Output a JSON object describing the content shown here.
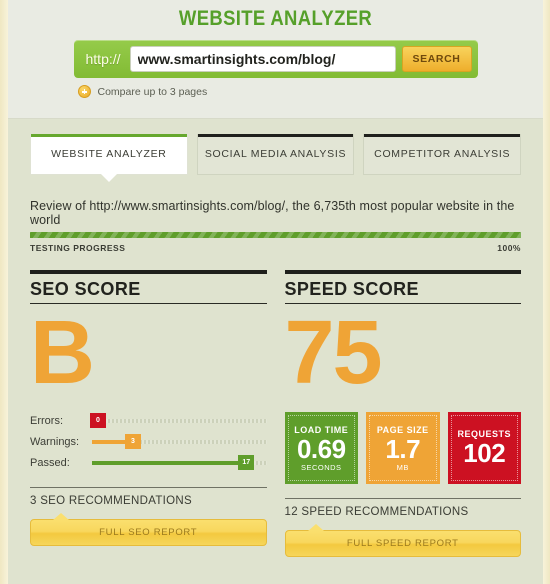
{
  "header": {
    "title": "WEBSITE ANALYZER",
    "protocol_label": "http://",
    "url_value": "www.smartinsights.com/blog/",
    "url_placeholder": "www.smartinsights.com/blog/",
    "search_button": "SEARCH",
    "compare_label": "Compare up to 3 pages",
    "plus_icon": "plus-circle-icon",
    "title_color": "#56a02a"
  },
  "tabs": [
    {
      "label": "WEBSITE ANALYZER",
      "active": true
    },
    {
      "label": "SOCIAL MEDIA ANALYSIS",
      "active": false
    },
    {
      "label": "COMPETITOR ANALYSIS",
      "active": false
    }
  ],
  "review": {
    "text": "Review of http://www.smartinsights.com/blog/, the 6,735th most popular website in the world",
    "progress_label": "TESTING PROGRESS",
    "progress_percent": "100%",
    "progress_value": 100,
    "progress_color": "#5f9e2b"
  },
  "seo": {
    "title": "SEO SCORE",
    "grade": "B",
    "grade_color": "#efa436",
    "sliders": [
      {
        "name": "Errors:",
        "value": "0",
        "fill_percent": 0,
        "color": "#cc1122"
      },
      {
        "name": "Warnings:",
        "value": "3",
        "fill_percent": 20,
        "color": "#efa436"
      },
      {
        "name": "Passed:",
        "value": "17",
        "fill_percent": 85,
        "color": "#5f9e2b"
      }
    ],
    "recommendations": "3 SEO RECOMMENDATIONS",
    "report_button": "FULL SEO REPORT"
  },
  "speed": {
    "title": "SPEED SCORE",
    "score": "75",
    "score_color": "#efa436",
    "metrics": [
      {
        "label": "LOAD TIME",
        "value": "0.69",
        "unit": "SECONDS",
        "color": "#5f9e2b"
      },
      {
        "label": "PAGE SIZE",
        "value": "1.7",
        "unit": "MB",
        "color": "#efa436"
      },
      {
        "label": "REQUESTS",
        "value": "102",
        "unit": "",
        "color": "#cc1122"
      }
    ],
    "recommendations": "12 SPEED RECOMMENDATIONS",
    "report_button": "FULL SPEED REPORT"
  }
}
